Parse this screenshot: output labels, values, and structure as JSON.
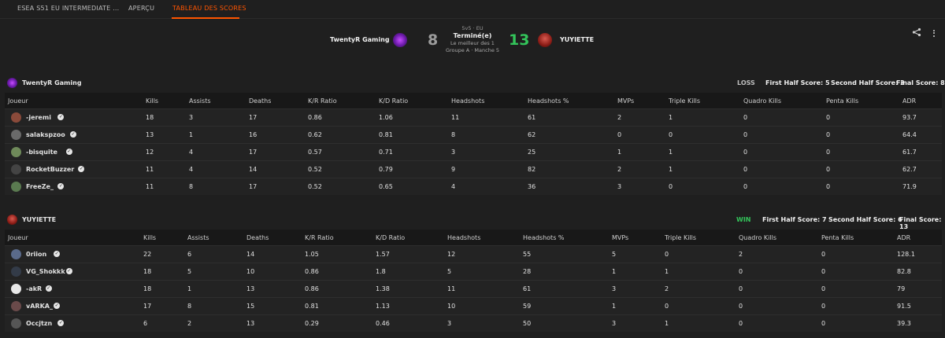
{
  "tabs": [
    {
      "label": "ESEA S51 EU INTERMEDIATE ..."
    },
    {
      "label": "APERÇU"
    },
    {
      "label": "TABLEAU DES SCORES"
    }
  ],
  "match": {
    "team_a": "TwentyR Gaming",
    "team_b": "YUYIETTE",
    "score_a": "8",
    "score_b": "13",
    "format": "5v5 · EU",
    "status": "Terminé(e)",
    "best_of": "Le meilleur des 1",
    "group": "Groupe A · Manche 5"
  },
  "columns": [
    "Joueur",
    "Kills",
    "Assists",
    "Deaths",
    "K/R Ratio",
    "K/D Ratio",
    "Headshots",
    "Headshots %",
    "MVPs",
    "Triple Kills",
    "Quadro Kills",
    "Penta Kills",
    "ADR"
  ],
  "teams": [
    {
      "name": "TwentyR Gaming",
      "result": "LOSS",
      "first_half": "First Half Score: 5",
      "second_half": "Second Half Score: 3",
      "final": "Final Score: 8",
      "rows": [
        [
          "-jeremi",
          "18",
          "3",
          "17",
          "0.86",
          "1.06",
          "11",
          "61",
          "2",
          "1",
          "0",
          "0",
          "93.7"
        ],
        [
          "salakspzoo",
          "13",
          "1",
          "16",
          "0.62",
          "0.81",
          "8",
          "62",
          "0",
          "0",
          "0",
          "0",
          "64.4"
        ],
        [
          "-bisquite",
          "12",
          "4",
          "17",
          "0.57",
          "0.71",
          "3",
          "25",
          "1",
          "1",
          "0",
          "0",
          "61.7"
        ],
        [
          "RocketBuzzer",
          "11",
          "4",
          "14",
          "0.52",
          "0.79",
          "9",
          "82",
          "2",
          "1",
          "0",
          "0",
          "62.7"
        ],
        [
          "FreeZe_",
          "11",
          "8",
          "17",
          "0.52",
          "0.65",
          "4",
          "36",
          "3",
          "0",
          "0",
          "0",
          "71.9"
        ]
      ]
    },
    {
      "name": "YUYIETTE",
      "result": "WIN",
      "first_half": "First Half Score: 7",
      "second_half": "Second Half Score: 6",
      "final": "Final Score: 13",
      "rows": [
        [
          "0riion",
          "22",
          "6",
          "14",
          "1.05",
          "1.57",
          "12",
          "55",
          "5",
          "0",
          "2",
          "0",
          "128.1"
        ],
        [
          "VG_Shokkk",
          "18",
          "5",
          "10",
          "0.86",
          "1.8",
          "5",
          "28",
          "1",
          "1",
          "0",
          "0",
          "82.8"
        ],
        [
          "-akR",
          "18",
          "1",
          "13",
          "0.86",
          "1.38",
          "11",
          "61",
          "3",
          "2",
          "0",
          "0",
          "79"
        ],
        [
          "vARKA_",
          "17",
          "8",
          "15",
          "0.81",
          "1.13",
          "10",
          "59",
          "1",
          "0",
          "0",
          "0",
          "91.5"
        ],
        [
          "Occjtzn",
          "6",
          "2",
          "13",
          "0.29",
          "0.46",
          "3",
          "50",
          "3",
          "1",
          "0",
          "0",
          "39.3"
        ]
      ]
    }
  ],
  "colors": {
    "accent": "#ff5500",
    "win": "#33c45a",
    "background": "#1f1f1f"
  }
}
